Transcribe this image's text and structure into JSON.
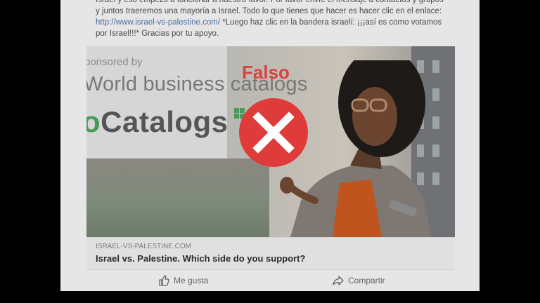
{
  "post": {
    "text_line1": "Israel y eso empezó a funcionar a nuestro favor.  Por favor envíe el mensaje a contactos y grupos",
    "text_line2": "y juntos traeremos una mayoría a Israel.  Todo lo que tienes que hacer es hacer clic en el enlace:",
    "link": "http://www.israel-vs-palestine.com/",
    "text_line3_rest": " *Luego haz clic en la bandera israelí: ¡¡¡así es como votamos",
    "text_line4": "por Israel!!!* Gracias por tu apoyo."
  },
  "ad": {
    "sponsored": "ponsored by",
    "brand": "World business catalogs",
    "catalogs": "Catalogs",
    "catalogs_prefix": "o",
    "stamp": "Falso"
  },
  "link_card": {
    "domain": "ISRAEL-VS-PALESTINE.COM",
    "headline": "Israel vs. Palestine. Which side do you support?"
  },
  "actions": {
    "like": "Me gusta",
    "share": "Compartir"
  },
  "colors": {
    "stamp_red": "#e03b3b",
    "link_blue": "#4b6fa6"
  }
}
